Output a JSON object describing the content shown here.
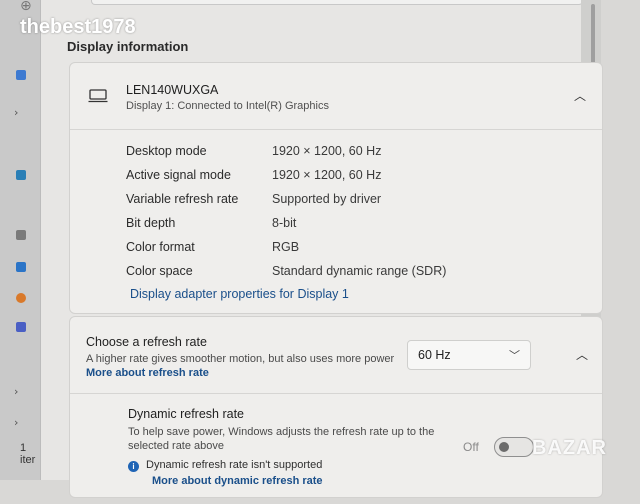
{
  "watermark": {
    "user": "thebest1978",
    "brand": "BAZAR"
  },
  "left_panel": {
    "status": "1 iter"
  },
  "section": {
    "title": "Display information"
  },
  "display": {
    "name": "LEN140WUXGA",
    "subtitle": "Display 1: Connected to Intel(R) Graphics",
    "rows": [
      {
        "label": "Desktop mode",
        "value": "1920 × 1200, 60 Hz"
      },
      {
        "label": "Active signal mode",
        "value": "1920 × 1200, 60 Hz"
      },
      {
        "label": "Variable refresh rate",
        "value": "Supported by driver"
      },
      {
        "label": "Bit depth",
        "value": "8-bit"
      },
      {
        "label": "Color format",
        "value": "RGB"
      },
      {
        "label": "Color space",
        "value": "Standard dynamic range (SDR)"
      }
    ],
    "adapter_link": "Display adapter properties for Display 1"
  },
  "refresh": {
    "title": "Choose a refresh rate",
    "desc_a": "A higher rate gives smoother motion, but also uses more",
    "desc_b": "power",
    "desc_link": "More about refresh rate",
    "selected": "60 Hz",
    "dynamic": {
      "title": "Dynamic refresh rate",
      "desc": "To help save power, Windows adjusts the refresh rate up to the selected rate above",
      "toggle_label": "Off",
      "toggle_on": false,
      "notice": "Dynamic refresh rate isn't supported",
      "more_link": "More about dynamic refresh rate"
    }
  },
  "colors": {
    "link": "#1a4f8a",
    "info_icon": "#1f64b5"
  }
}
